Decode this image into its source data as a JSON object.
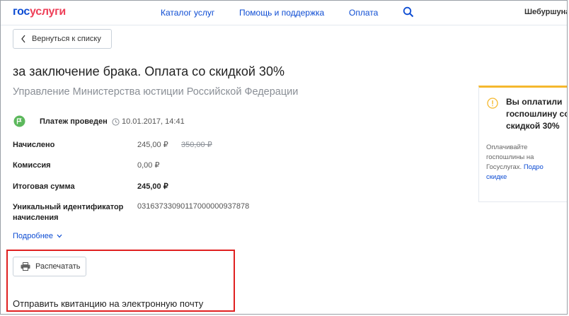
{
  "header": {
    "logo_part1": "гос",
    "logo_part2": "услуги",
    "nav": [
      "Каталог услуг",
      "Помощь и поддержка",
      "Оплата"
    ],
    "user_name": "Шебуршуна",
    "search_icon": "search-icon"
  },
  "back_button": {
    "label": "Вернуться к списку",
    "icon": "chevron-left-icon"
  },
  "page": {
    "title": "за заключение брака. Оплата со скидкой 30%",
    "subtitle": "Управление Министерства юстиции Российской Федерации"
  },
  "status": {
    "label": "Платеж проведен",
    "date": "10.01.2017, 14:41",
    "color": "#5cb85c"
  },
  "details": {
    "charged_label": "Начислено",
    "charged_value": "245,00 ₽",
    "charged_old_value": "350,00 ₽",
    "commission_label": "Комиссия",
    "commission_value": "0,00 ₽",
    "total_label": "Итоговая сумма",
    "total_value": "245,00 ₽",
    "uid_label_line1": "Уникальный идентификатор",
    "uid_label_line2": "начисления",
    "uid_value": "03163733090117000000937878"
  },
  "more_link": "Подробнее",
  "print_button": {
    "label": "Распечатать",
    "icon": "printer-icon"
  },
  "email_text": "Отправить квитанцию на электронную почту",
  "info_panel": {
    "title_line1": "Вы оплатили",
    "title_line2": "госпошлину со",
    "title_line3": "скидкой 30%",
    "text_line1": "Оплачивайте",
    "text_line2": "госпошлины на",
    "text_line3": "Госуслугах.",
    "link_part1": "Подро",
    "link_part2": "скидке",
    "accent_color": "#f5b82e"
  }
}
